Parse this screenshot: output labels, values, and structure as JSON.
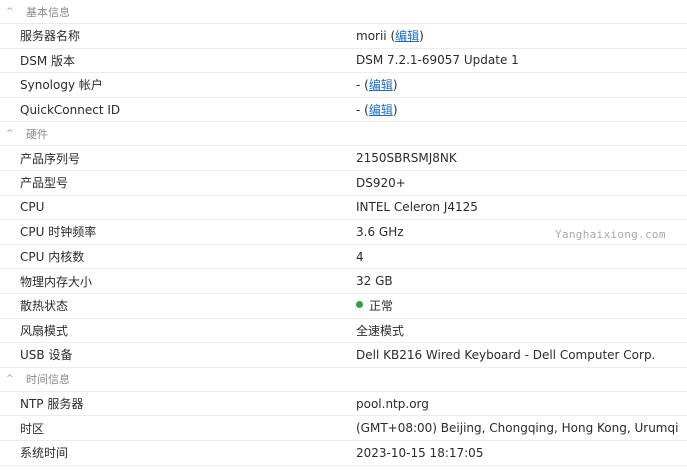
{
  "sections": {
    "basic": {
      "title": "基本信息",
      "server_name": {
        "label": "服务器名称",
        "value": "morii",
        "edit": "编辑"
      },
      "dsm_version": {
        "label": "DSM 版本",
        "value": "DSM 7.2.1-69057 Update 1"
      },
      "synology_account": {
        "label": "Synology 帐户",
        "value": "-",
        "edit": "编辑"
      },
      "quickconnect_id": {
        "label": "QuickConnect ID",
        "value": "-",
        "edit": "编辑"
      }
    },
    "hardware": {
      "title": "硬件",
      "serial": {
        "label": "产品序列号",
        "value": "2150SBRSMJ8NK"
      },
      "model": {
        "label": "产品型号",
        "value": "DS920+"
      },
      "cpu": {
        "label": "CPU",
        "value": "INTEL Celeron J4125"
      },
      "cpu_clock": {
        "label": "CPU 时钟频率",
        "value": "3.6 GHz"
      },
      "cpu_cores": {
        "label": "CPU 内核数",
        "value": "4"
      },
      "memory": {
        "label": "物理内存大小",
        "value": "32 GB"
      },
      "thermal": {
        "label": "散热状态",
        "value": "正常",
        "status_color": "#2ea043"
      },
      "fan_mode": {
        "label": "风扇模式",
        "value": "全速模式"
      },
      "usb": {
        "label": "USB 设备",
        "value": "Dell KB216 Wired Keyboard - Dell Computer Corp."
      }
    },
    "time": {
      "title": "时间信息",
      "ntp": {
        "label": "NTP 服务器",
        "value": "pool.ntp.org"
      },
      "timezone": {
        "label": "时区",
        "value": "(GMT+08:00) Beijing, Chongqing, Hong Kong, Urumqi"
      },
      "system_time": {
        "label": "系统时间",
        "value": "2023-10-15 18:17:05"
      }
    }
  },
  "watermark": "Yanghaixiong.com",
  "icons": {
    "section_toggle": "caret-up-icon",
    "status": "green-dot-icon"
  }
}
